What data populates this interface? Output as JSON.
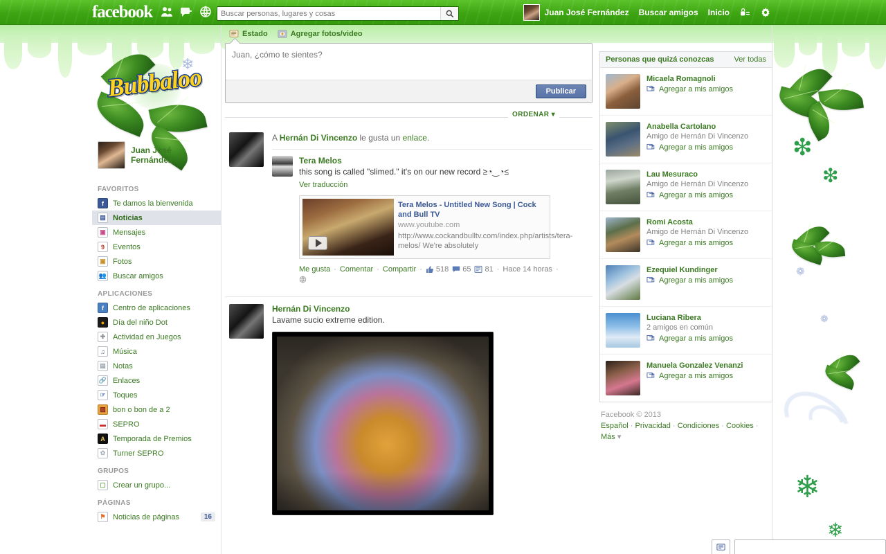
{
  "topbar": {
    "logo": "facebook",
    "icons": [
      {
        "name": "friend-requests-icon",
        "glyph": "friends"
      },
      {
        "name": "messages-icon",
        "glyph": "messages"
      },
      {
        "name": "notifications-icon",
        "glyph": "globe"
      }
    ],
    "search": {
      "placeholder": "Buscar personas, lugares y cosas",
      "value": "",
      "button_icon": "search-icon"
    },
    "account_name": "Juan José Fernández",
    "find_friends": "Buscar amigos",
    "home": "Inicio",
    "privacy_icon": "privacy-lock-icon",
    "settings_icon": "gear-icon"
  },
  "brand": {
    "logo_text": "Bubbaloo"
  },
  "sidebar": {
    "profile_name_line1": "Juan José",
    "profile_name_line2": "Fernández",
    "sections": [
      {
        "heading": "FAVORITOS",
        "items": [
          {
            "label": "Te damos la bienvenida",
            "icon": "facebook-f-icon",
            "icon_bg": "#3b5998",
            "icon_fg": "#ffffff",
            "glyph": "f",
            "active": false
          },
          {
            "label": "Noticias",
            "icon": "news-feed-icon",
            "icon_bg": "#ffffff",
            "icon_fg": "#3b5998",
            "glyph": "▤",
            "active": true
          },
          {
            "label": "Mensajes",
            "icon": "messages-icon",
            "icon_bg": "#ffffff",
            "icon_fg": "#c74b8a",
            "glyph": "▣",
            "active": false
          },
          {
            "label": "Eventos",
            "icon": "events-calendar-icon",
            "icon_bg": "#ffffff",
            "icon_fg": "#c0392b",
            "glyph": "9",
            "active": false
          },
          {
            "label": "Fotos",
            "icon": "photos-icon",
            "icon_bg": "#ffffff",
            "icon_fg": "#c8922a",
            "glyph": "▣",
            "active": false
          },
          {
            "label": "Buscar amigos",
            "icon": "find-friends-icon",
            "icon_bg": "#ffffff",
            "icon_fg": "#3b5998",
            "glyph": "👥",
            "active": false
          }
        ]
      },
      {
        "heading": "APLICACIONES",
        "items": [
          {
            "label": "Centro de aplicaciones",
            "icon": "app-center-icon",
            "icon_bg": "#4a7fc1",
            "icon_fg": "#ffffff",
            "glyph": "f",
            "active": false
          },
          {
            "label": "Día del niño Dot",
            "icon": "dot-app-icon",
            "icon_bg": "#1b1b1b",
            "icon_fg": "#f0a500",
            "glyph": "●",
            "active": false
          },
          {
            "label": "Actividad en Juegos",
            "icon": "games-activity-icon",
            "icon_bg": "#ffffff",
            "icon_fg": "#8e9299",
            "glyph": "✚",
            "active": false
          },
          {
            "label": "Música",
            "icon": "music-icon",
            "icon_bg": "#ffffff",
            "icon_fg": "#5a6a86",
            "glyph": "♫",
            "active": false
          },
          {
            "label": "Notas",
            "icon": "notes-icon",
            "icon_bg": "#ffffff",
            "icon_fg": "#9aa3ad",
            "glyph": "▤",
            "active": false
          },
          {
            "label": "Enlaces",
            "icon": "links-icon",
            "icon_bg": "#ffffff",
            "icon_fg": "#4a7fc1",
            "glyph": "🔗",
            "active": false
          },
          {
            "label": "Toques",
            "icon": "pokes-icon",
            "icon_bg": "#ffffff",
            "icon_fg": "#5e80b4",
            "glyph": "☞",
            "active": false
          },
          {
            "label": "bon o bon de a 2",
            "icon": "bonobon-app-icon",
            "icon_bg": "#e8a33d",
            "icon_fg": "#8a2020",
            "glyph": "▨",
            "active": false
          },
          {
            "label": "SEPRO",
            "icon": "sepro-app-icon",
            "icon_bg": "#ffffff",
            "icon_fg": "#cc2b2b",
            "glyph": "▬",
            "active": false
          },
          {
            "label": "Temporada de Premios",
            "icon": "temporada-premios-icon",
            "icon_bg": "#111111",
            "icon_fg": "#e6c35a",
            "glyph": "A",
            "active": false
          },
          {
            "label": "Turner SEPRO",
            "icon": "turner-sepro-icon",
            "icon_bg": "#ffffff",
            "icon_fg": "#a9b4c2",
            "glyph": "✿",
            "active": false
          }
        ]
      },
      {
        "heading": "GRUPOS",
        "items": [
          {
            "label": "Crear un grupo...",
            "icon": "create-group-icon",
            "icon_bg": "#ffffff",
            "icon_fg": "#6aa84f",
            "glyph": "▢",
            "active": false
          }
        ]
      },
      {
        "heading": "PÁGINAS",
        "items": [
          {
            "label": "Noticias de páginas",
            "icon": "pages-feed-icon",
            "icon_bg": "#ffffff",
            "icon_fg": "#e06b2a",
            "glyph": "⚑",
            "active": false,
            "badge": "16"
          }
        ]
      }
    ]
  },
  "composer": {
    "tabs": [
      {
        "label": "Estado",
        "icon": "status-icon"
      },
      {
        "label": "Agregar fotos/video",
        "icon": "photo-video-icon"
      }
    ],
    "placeholder": "Juan, ¿cómo te sientes?",
    "value": "",
    "publish_label": "Publicar"
  },
  "feed": {
    "sort_label": "ORDENAR",
    "posts": [
      {
        "type": "shared-link",
        "header_prefix": "A",
        "header_actor": "Hernán Di Vincenzo",
        "header_mid": "le gusta un",
        "header_object": "enlace",
        "header_suffix": ".",
        "shared_page": "Tera Melos",
        "shared_text": "this song is called \"slimed.\" it's on our new record ≥◔‿◔≤",
        "translate_label": "Ver traducción",
        "attachment": {
          "title": "Tera Melos - Untitled New Song | Cock and Bull TV",
          "domain": "www.youtube.com",
          "description": "http://www.cockandbulltv.com/index.php/artists/tera-melos/ We're absolutely",
          "play_icon": "play-icon"
        },
        "actions": {
          "like": "Me gusta",
          "comment": "Comentar",
          "share": "Compartir",
          "like_count": "518",
          "comment_count": "65",
          "share_count": "81",
          "time": "Hace 14 horas",
          "privacy_icon": "globe-icon"
        }
      },
      {
        "type": "photo",
        "author": "Hernán Di Vincenzo",
        "text": "Lavame sucio extreme edition."
      }
    ]
  },
  "right_sidebar": {
    "pymk_title": "Personas que quizá conozcas",
    "pymk_see_all": "Ver todas",
    "add_friend_label": "Agregar a mis amigos",
    "people": [
      {
        "name": "Micaela Romagnoli",
        "sub": "",
        "pic": "p1"
      },
      {
        "name": "Anabella Cartolano",
        "sub": "Amigo de Hernán Di Vincenzo",
        "pic": "p2"
      },
      {
        "name": "Lau Mesuraco",
        "sub": "Amigo de Hernán Di Vincenzo",
        "pic": "p3"
      },
      {
        "name": "Romi Acosta",
        "sub": "Amigo de Hernán Di Vincenzo",
        "pic": "p4"
      },
      {
        "name": "Ezequiel Kundinger",
        "sub": "",
        "pic": "p5"
      },
      {
        "name": "Luciana Ribera",
        "sub": "2 amigos en común",
        "pic": "p6"
      },
      {
        "name": "Manuela Gonzalez Venanzi",
        "sub": "",
        "pic": "p7"
      }
    ],
    "footer": {
      "copyright": "Facebook © 2013",
      "links": [
        "Español",
        "Privacidad",
        "Condiciones",
        "Cookies",
        "Más"
      ]
    }
  },
  "chatbar": {
    "icon": "chat-icon",
    "label": ""
  },
  "colors": {
    "brand_green": "#3da512",
    "link_green": "#3b7a22",
    "attachment_blue": "#3b5998",
    "badge_bg": "#e9ebee"
  }
}
